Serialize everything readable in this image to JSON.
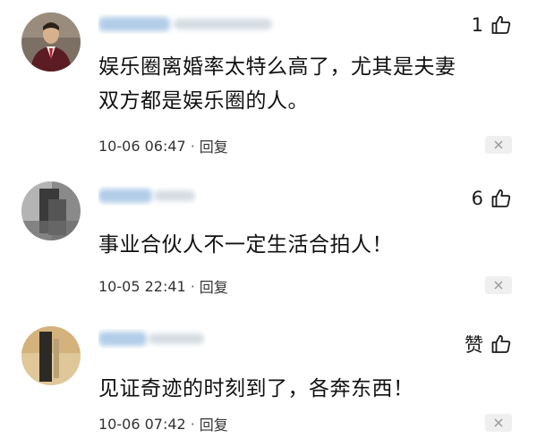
{
  "comments": [
    {
      "likes": "1",
      "text_lines": [
        "娱乐圈离婚率太特么高了，尤其是夫妻",
        "双方都是娱乐圈的人。"
      ],
      "timestamp": "10-06 06:47",
      "separator": "·",
      "reply_label": "回复"
    },
    {
      "likes": "6",
      "text_lines": [
        "事业合伙人不一定生活合拍人！"
      ],
      "timestamp": "10-05 22:41",
      "separator": "·",
      "reply_label": "回复"
    },
    {
      "likes": "赞",
      "text_lines": [
        "见证奇迹的时刻到了，各奔东西！"
      ],
      "timestamp": "10-06 07:42",
      "separator": "·",
      "reply_label": "回复"
    }
  ],
  "icons": {
    "like": "thumbs-up-icon",
    "close": "close-icon"
  },
  "colors": {
    "text": "#111111",
    "meta": "#333333",
    "close_bg": "#efefef"
  }
}
